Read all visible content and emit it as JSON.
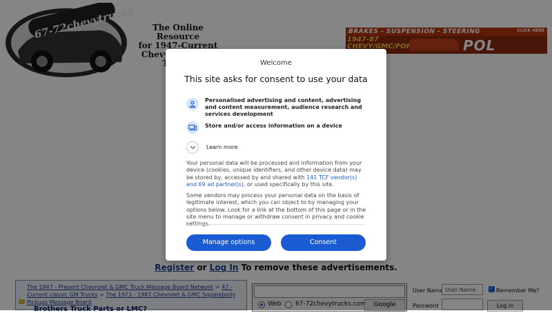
{
  "site": {
    "logo_text": "67-72chevytrucks.com",
    "tagline": [
      "The Online Resource",
      "for 1947-Current",
      "Chevy and GMC Trucks",
      "si"
    ],
    "ad": {
      "strip": "BRAKES - SUSPENSION - STEERING",
      "model": "1947-87 CHEVY/GMC/FORD",
      "brand": "POL",
      "click": "CLICK HERE"
    },
    "register": {
      "register_link": "Register",
      "or": "or",
      "login_link": "Log In",
      "suffix": "To remove these advertisements."
    }
  },
  "forum": {
    "breadcrumb": [
      "The 1947 - Present Chevrolet & GMC Truck Message Board Network",
      "47 - Current classic GM Trucks",
      "The 1973 - 1987 Chevrolet & GMC Squarebody Pickups Message Board"
    ],
    "separator": ">",
    "thread_title": "Brothers Truck Parts or LMC?"
  },
  "search": {
    "options": [
      "Web",
      "67-72chevytrucks.com"
    ],
    "selected": "Web",
    "button": "Google"
  },
  "login": {
    "username_label": "User Name",
    "username_placeholder": "User Name",
    "remember_label": "Remember Me?",
    "remember_checked": true,
    "password_label": "Password",
    "login_button": "Log in"
  },
  "consent": {
    "welcome": "Welcome",
    "title": "This site asks for consent to use your data",
    "purposes": [
      {
        "icon": "person-icon",
        "text": "Personalised advertising and content, advertising and content measurement, audience research and services development"
      },
      {
        "icon": "device-icon",
        "text": "Store and/or access information on a device"
      }
    ],
    "learn_more": "Learn more",
    "paragraph1_before": "Your personal data will be processed and information from your device (cookies, unique identifiers, and other device data) may be stored by, accessed by and shared with",
    "paragraph1_link": "141 TCF vendor(s) and 69 ad partner(s)",
    "paragraph1_after": ", or used specifically by this site.",
    "paragraph2": "Some vendors may process your personal data on the basis of legitimate interest, which you can object to by managing your options below. Look for a link at the bottom of this page or in the site menu to manage or withdraw consent in privacy and cookie settings.",
    "manage_button": "Manage options",
    "consent_button": "Consent",
    "accent_color": "#1a5bd1"
  }
}
